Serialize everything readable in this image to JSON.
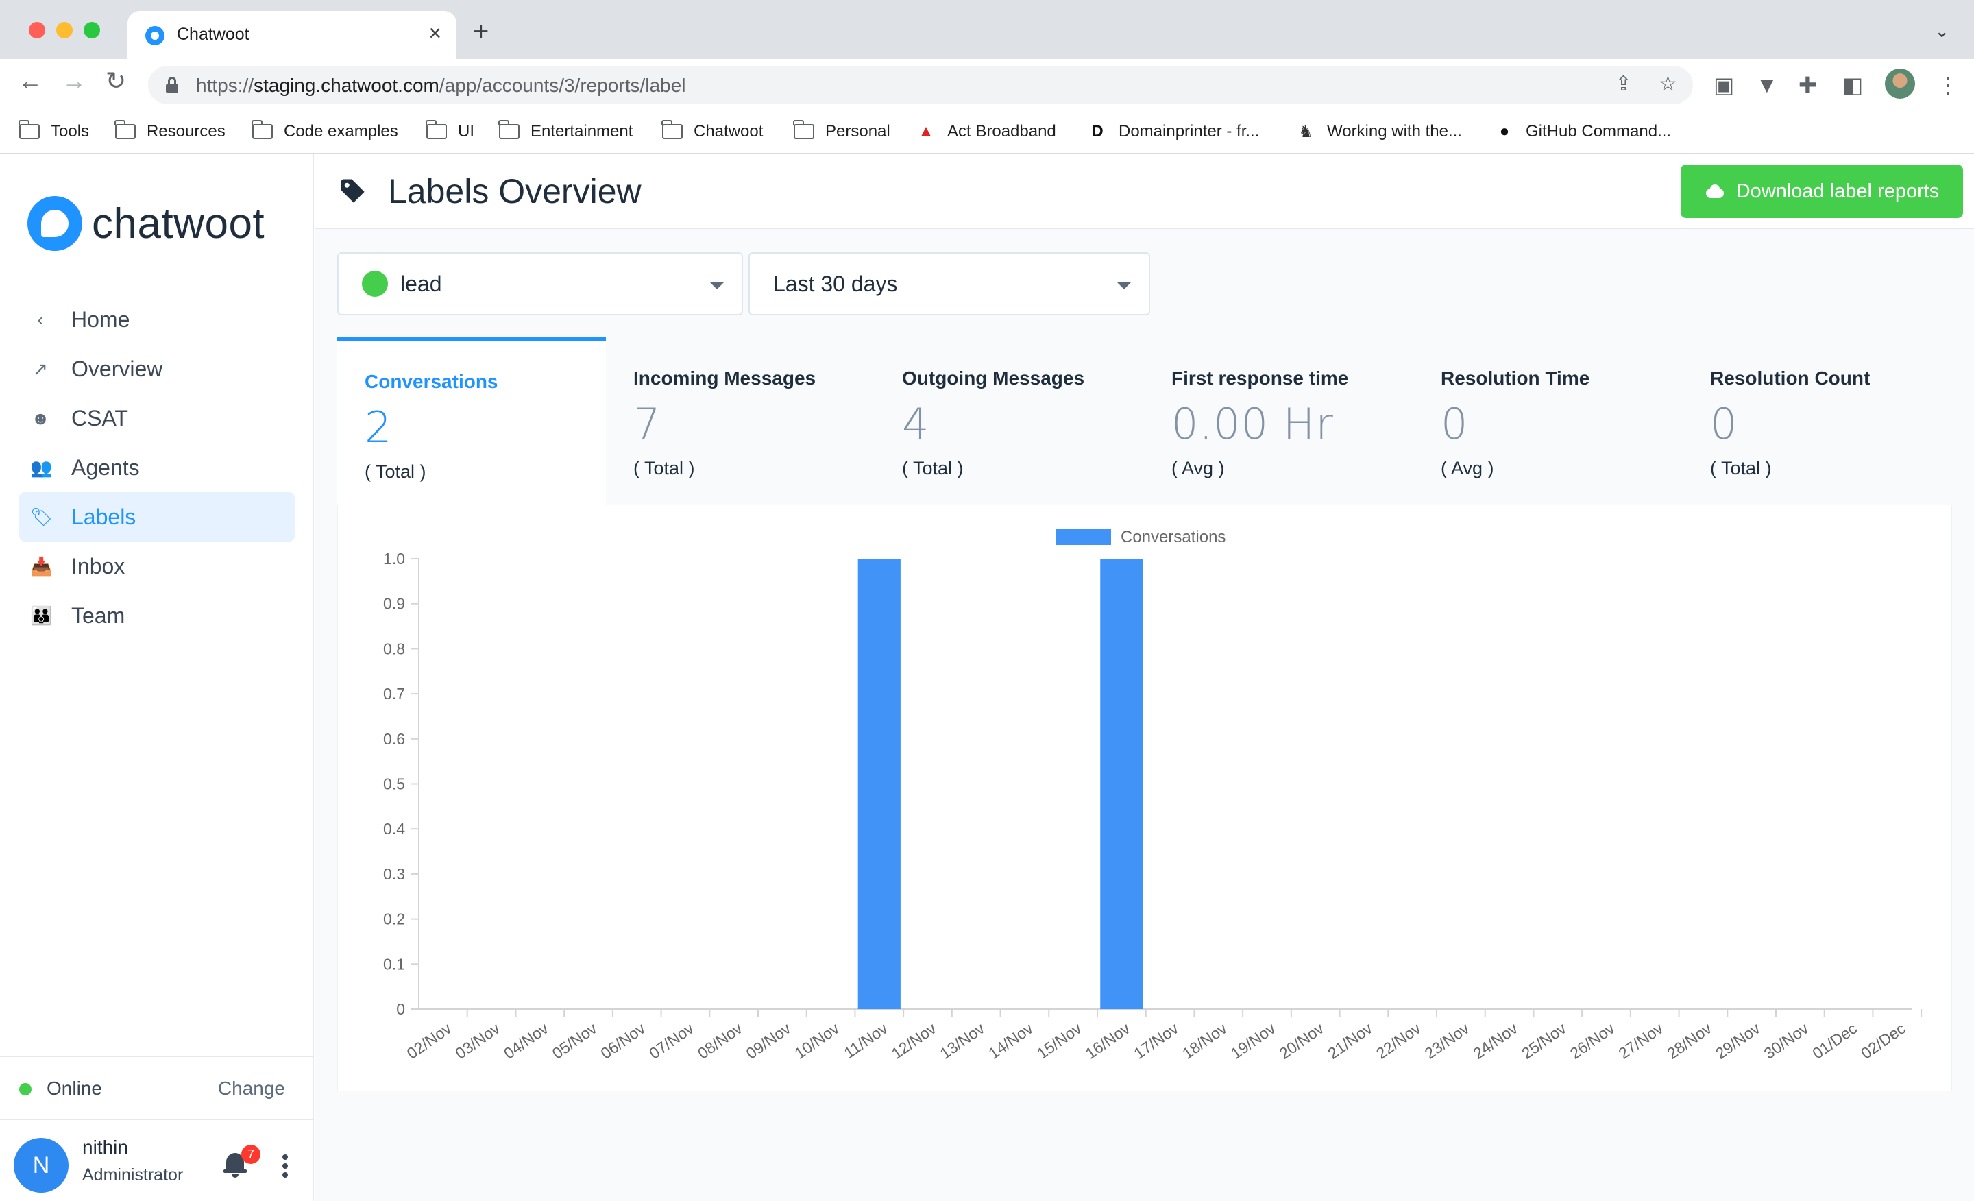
{
  "browser": {
    "tab_title": "Chatwoot",
    "tab_close": "×",
    "new_tab": "+",
    "tab_search": "⌄",
    "url_prefix": "https://",
    "url_host": "staging.chatwoot.com",
    "url_path": "/app/accounts/3/reports/label",
    "bookmarks": [
      {
        "label": "Tools",
        "icon": "folder-icon"
      },
      {
        "label": "Resources",
        "icon": "folder-icon"
      },
      {
        "label": "Code examples",
        "icon": "folder-icon"
      },
      {
        "label": "UI",
        "icon": "folder-icon"
      },
      {
        "label": "Entertainment",
        "icon": "folder-icon"
      },
      {
        "label": "Chatwoot",
        "icon": "folder-icon"
      },
      {
        "label": "Personal",
        "icon": "folder-icon"
      },
      {
        "label": "Act Broadband",
        "icon": "act-logo-icon"
      },
      {
        "label": "Domainprinter - fr...",
        "icon": "domainprinter-icon"
      },
      {
        "label": "Working with the...",
        "icon": "fox-icon"
      },
      {
        "label": "GitHub Command...",
        "icon": "github-icon"
      }
    ]
  },
  "sidebar": {
    "logo_text": "chatwoot",
    "items": [
      {
        "label": "Home",
        "icon": "chevron-left-icon",
        "glyph": "‹"
      },
      {
        "label": "Overview",
        "icon": "trend-icon",
        "glyph": "↗"
      },
      {
        "label": "CSAT",
        "icon": "smiley-icon",
        "glyph": "☻"
      },
      {
        "label": "Agents",
        "icon": "people-icon",
        "glyph": "👥"
      },
      {
        "label": "Labels",
        "icon": "tag-icon",
        "glyph": "🏷",
        "active": true
      },
      {
        "label": "Inbox",
        "icon": "inbox-icon",
        "glyph": "📥"
      },
      {
        "label": "Team",
        "icon": "team-icon",
        "glyph": "👪"
      }
    ],
    "status": {
      "label": "Online",
      "change": "Change"
    },
    "user": {
      "initial": "N",
      "name": "nithin",
      "role": "Administrator",
      "notifications": "7"
    }
  },
  "header": {
    "title": "Labels Overview",
    "download_button": "Download label reports"
  },
  "filters": {
    "label": "lead",
    "label_color": "#44ce4b",
    "range": "Last 30 days"
  },
  "metrics": [
    {
      "title": "Conversations",
      "value": "2",
      "sub": "( Total )",
      "active": true
    },
    {
      "title": "Incoming Messages",
      "value": "7",
      "sub": "( Total )"
    },
    {
      "title": "Outgoing Messages",
      "value": "4",
      "sub": "( Total )"
    },
    {
      "title": "First response time",
      "value": "0.00 Hr",
      "sub": "( Avg )"
    },
    {
      "title": "Resolution Time",
      "value": "0",
      "sub": "( Avg )"
    },
    {
      "title": "Resolution Count",
      "value": "0",
      "sub": "( Total )"
    }
  ],
  "colors": {
    "accent": "#1f93ff",
    "success": "#44ce4b",
    "bar": "#4193f7"
  },
  "chart_data": {
    "type": "bar",
    "legend": "Conversations",
    "legend_position": "top-center",
    "categories": [
      "02/Nov",
      "03/Nov",
      "04/Nov",
      "05/Nov",
      "06/Nov",
      "07/Nov",
      "08/Nov",
      "09/Nov",
      "10/Nov",
      "11/Nov",
      "12/Nov",
      "13/Nov",
      "14/Nov",
      "15/Nov",
      "16/Nov",
      "17/Nov",
      "18/Nov",
      "19/Nov",
      "20/Nov",
      "21/Nov",
      "22/Nov",
      "23/Nov",
      "24/Nov",
      "25/Nov",
      "26/Nov",
      "27/Nov",
      "28/Nov",
      "29/Nov",
      "30/Nov",
      "01/Dec",
      "02/Dec"
    ],
    "series": [
      {
        "name": "Conversations",
        "values": [
          0,
          0,
          0,
          0,
          0,
          0,
          0,
          0,
          0,
          1,
          0,
          0,
          0,
          0,
          1,
          0,
          0,
          0,
          0,
          0,
          0,
          0,
          0,
          0,
          0,
          0,
          0,
          0,
          0,
          0,
          0
        ]
      }
    ],
    "ylim": [
      0,
      1
    ],
    "yticks": [
      "0",
      "0.1",
      "0.2",
      "0.3",
      "0.4",
      "0.5",
      "0.6",
      "0.7",
      "0.8",
      "0.9",
      "1.0"
    ],
    "grid": false
  }
}
